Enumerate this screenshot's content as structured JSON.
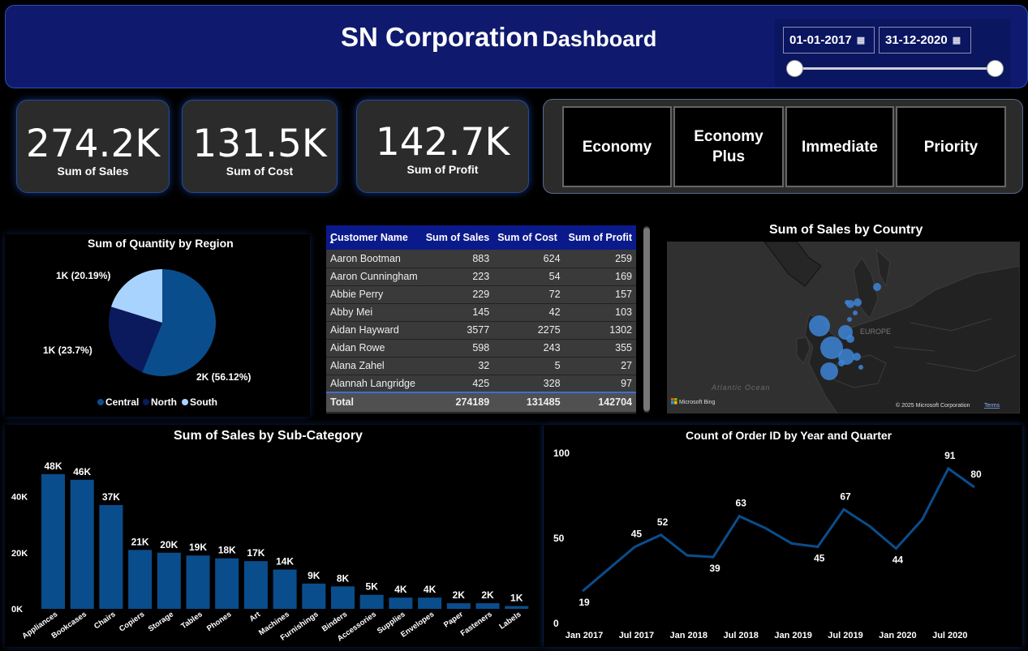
{
  "header": {
    "title_main": "SN Corporation",
    "title_sub": "Dashboard",
    "date_start": "01-01-2017",
    "date_end": "31-12-2020",
    "calendar_icon": "calendar-icon",
    "slider_range": [
      0,
      1
    ]
  },
  "kpis": [
    {
      "value": "274.2K",
      "label": "Sum of Sales"
    },
    {
      "value": "131.5K",
      "label": "Sum of Cost"
    },
    {
      "value": "142.7K",
      "label": "Sum of Profit"
    }
  ],
  "ship_modes": [
    "Economy",
    "Economy Plus",
    "Immediate",
    "Priority"
  ],
  "colors": {
    "header_bg": "#0f1a6e",
    "bar": "#0a4d8c",
    "line": "#0a4d8c",
    "pie_central": "#0a4d8c",
    "pie_north": "#0b1a5c",
    "pie_south": "#a9d3ff",
    "table_header": "#0b1a8a"
  },
  "pie": {
    "title": "Sum of Quantity by Region",
    "legend": [
      "Central",
      "North",
      "South"
    ],
    "labels": [
      "2K (56.12%)",
      "1K (23.7%)",
      "1K (20.19%)"
    ]
  },
  "table": {
    "columns": [
      "Customer Name",
      "Sum of Sales",
      "Sum of Cost",
      "Sum of Profit"
    ],
    "sort_icon": "sort-ascending-icon",
    "rows": [
      [
        "Aaron Bootman",
        "883",
        "624",
        "259"
      ],
      [
        "Aaron Cunningham",
        "223",
        "54",
        "169"
      ],
      [
        "Abbie Perry",
        "229",
        "72",
        "157"
      ],
      [
        "Abby Mei",
        "145",
        "42",
        "103"
      ],
      [
        "Aidan Hayward",
        "3577",
        "2275",
        "1302"
      ],
      [
        "Aidan Rowe",
        "598",
        "243",
        "355"
      ],
      [
        "Alana Zahel",
        "32",
        "5",
        "27"
      ],
      [
        "Alannah Langridge",
        "425",
        "328",
        "97"
      ]
    ],
    "total": [
      "Total",
      "274189",
      "131485",
      "142704"
    ]
  },
  "map": {
    "title": "Sum of Sales by Country",
    "ocean_label": "Atlantic Ocean",
    "region_label": "EUROPE",
    "bing_logo": "Microsoft Bing",
    "copyright": "© 2025 Microsoft Corporation",
    "terms": "Terms"
  },
  "chart_data": [
    {
      "type": "pie",
      "title": "Sum of Quantity by Region",
      "categories": [
        "Central",
        "North",
        "South"
      ],
      "values": [
        56.12,
        23.7,
        20.19
      ],
      "data_labels": [
        "2K (56.12%)",
        "1K (23.7%)",
        "1K (20.19%)"
      ],
      "legend_position": "bottom"
    },
    {
      "type": "bar",
      "title": "Sum of Sales by Sub-Category",
      "categories": [
        "Appliances",
        "Bookcases",
        "Chairs",
        "Copiers",
        "Storage",
        "Tables",
        "Phones",
        "Art",
        "Machines",
        "Furnishings",
        "Binders",
        "Accessories",
        "Supplies",
        "Envelopes",
        "Paper",
        "Fasteners",
        "Labels"
      ],
      "values": [
        48000,
        46000,
        37000,
        21000,
        20000,
        19000,
        18000,
        17000,
        14000,
        9000,
        8000,
        5000,
        4000,
        4000,
        2000,
        2000,
        1000
      ],
      "data_labels": [
        "48K",
        "46K",
        "37K",
        "21K",
        "20K",
        "19K",
        "18K",
        "17K",
        "14K",
        "9K",
        "8K",
        "5K",
        "4K",
        "4K",
        "2K",
        "2K",
        "1K"
      ],
      "yticks": [
        "0K",
        "20K",
        "40K"
      ],
      "ylim": [
        0,
        52000
      ]
    },
    {
      "type": "line",
      "title": "Count of Order ID by Year and Quarter",
      "x": [
        "2017 Q1",
        "2017 Q2",
        "2017 Q3",
        "2017 Q4",
        "2018 Q1",
        "2018 Q2",
        "2018 Q3",
        "2018 Q4",
        "2019 Q1",
        "2019 Q2",
        "2019 Q3",
        "2019 Q4",
        "2020 Q1",
        "2020 Q2",
        "2020 Q3",
        "2020 Q4"
      ],
      "values": [
        19,
        32,
        45,
        52,
        40,
        39,
        63,
        56,
        47,
        45,
        67,
        57,
        44,
        61,
        91,
        80
      ],
      "point_labels": {
        "0": "19",
        "2": "45",
        "3": "52",
        "5": "39",
        "6": "63",
        "9": "45",
        "10": "67",
        "12": "44",
        "14": "91",
        "15": "80"
      },
      "xticks": [
        "Jan 2017",
        "Jul 2017",
        "Jan 2018",
        "Jul 2018",
        "Jan 2019",
        "Jul 2019",
        "Jan 2020",
        "Jul 2020"
      ],
      "yticks": [
        "0",
        "50",
        "100"
      ],
      "ylim": [
        0,
        100
      ]
    }
  ]
}
